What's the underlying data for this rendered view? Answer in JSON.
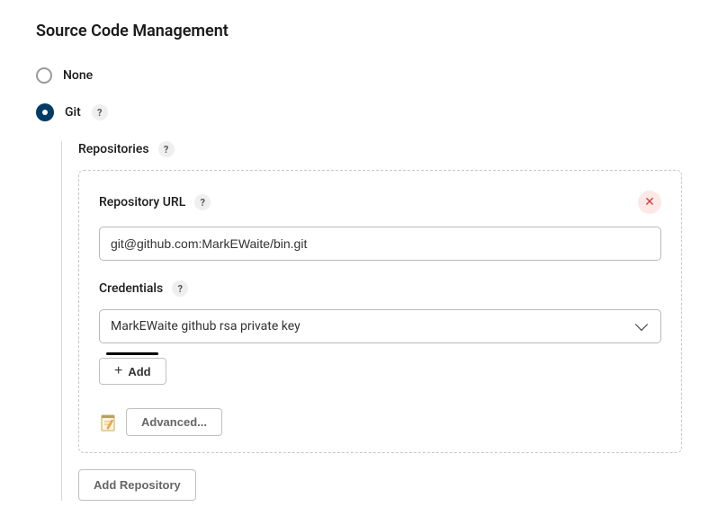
{
  "title": "Source Code Management",
  "scm": {
    "none": {
      "label": "None",
      "selected": false
    },
    "git": {
      "label": "Git",
      "selected": true
    }
  },
  "repositories": {
    "label": "Repositories",
    "repo_url_label": "Repository URL",
    "repo_url_value": "git@github.com:MarkEWaite/bin.git",
    "credentials_label": "Credentials",
    "credentials_value": "MarkEWaite github rsa private key",
    "add_label": "Add",
    "advanced_label": "Advanced...",
    "help_glyph": "?"
  },
  "add_repository_label": "Add Repository"
}
